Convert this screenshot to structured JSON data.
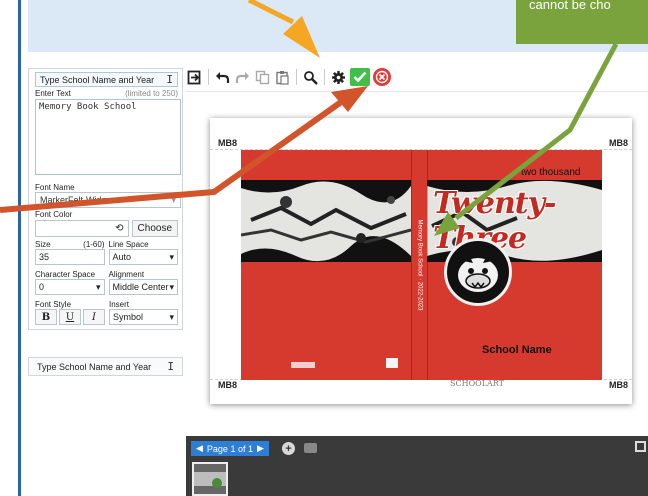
{
  "callout": {
    "text": "cannot be cho"
  },
  "panel": {
    "header_title": "Type School Name and Year",
    "enter_text_label": "Enter Text",
    "limit_text": "(limited to 250)",
    "text_value": "Memory Book School",
    "font_name_label": "Font Name",
    "font_name_value": "MarkerFelt-Wide",
    "font_color_label": "Font Color",
    "choose_label": "Choose",
    "size_label": "Size",
    "size_range": "(1-60)",
    "size_value": "35",
    "line_space_label": "Line Space",
    "line_space_value": "Auto",
    "char_space_label": "Character Space",
    "char_space_value": "0",
    "alignment_label": "Alignment",
    "alignment_value": "Middle Center",
    "font_style_label": "Font Style",
    "bold_label": "B",
    "underline_label": "U",
    "italic_label": "I",
    "insert_label": "Insert",
    "insert_value": "Symbol",
    "bottom_item_title": "Type School Name and Year"
  },
  "cover": {
    "crop_mark": "MB8",
    "headline_small": "two thousand",
    "headline_script": "Twenty-Three",
    "school_name": "School Name",
    "spine_text": "Memory Book School · 2022-2023",
    "school_art": "SCHOOLART"
  },
  "bottom_bar": {
    "page_label": "Page 1 of 1"
  },
  "colors": {
    "accent_blue": "#2d7fd6",
    "cover_red": "#d63a2f",
    "callout_green": "#7aa33d",
    "arrow_orange": "#f5a623",
    "arrow_red": "#d2542b"
  }
}
